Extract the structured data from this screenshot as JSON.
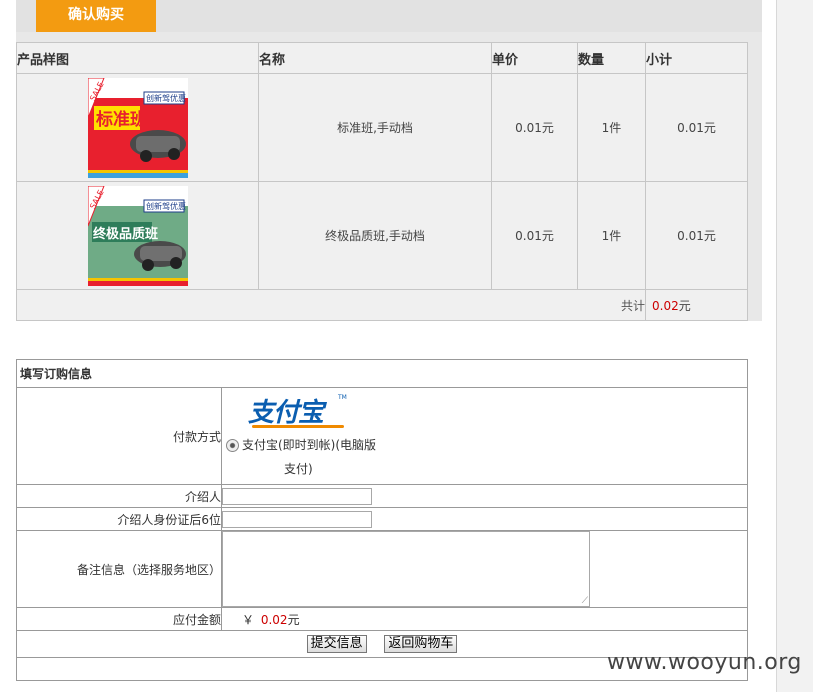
{
  "header": {
    "confirm_tab": "确认购买"
  },
  "cart": {
    "headers": [
      "产品样图",
      "名称",
      "单价",
      "数量",
      "小计"
    ],
    "rows": [
      {
        "name": "标准班,手动档",
        "price": "0.01元",
        "qty": "1件",
        "subtotal": "0.01元",
        "thumb": {
          "ribbon": "SALE",
          "title": "标准班",
          "promo": "创新驾优惠",
          "bg": "#e8202e"
        }
      },
      {
        "name": "终极品质班,手动档",
        "price": "0.01元",
        "qty": "1件",
        "subtotal": "0.01元",
        "thumb": {
          "ribbon": "SALE",
          "title": "终极品质班",
          "promo": "创新驾优惠",
          "bg": "#6fab86"
        }
      }
    ],
    "total_label": "共计",
    "total_value": "0.02",
    "total_unit": "元"
  },
  "order": {
    "title": "填写订购信息",
    "payment_label": "付款方式",
    "alipay_logo": "支付宝",
    "alipay_tm": "TM",
    "payment_option_line1": "支付宝(即时到帐)(电脑版",
    "payment_option_line2": "支付)",
    "referrer_label": "介绍人",
    "referrer_value": "",
    "referrer_id_label": "介绍人身份证后6位",
    "referrer_id_value": "",
    "remark_label": "备注信息（选择服务地区）",
    "amount_label": "应付金额",
    "amount_currency": "￥",
    "amount_value": "0.02",
    "amount_unit": "元",
    "submit_button": "提交信息",
    "back_button": "返回购物车"
  },
  "watermark": "www.wooyun.org",
  "colors": {
    "accent": "#f39b11",
    "price": "#cc0000",
    "alipay_blue": "#0b5eb0",
    "alipay_orange": "#f08a00"
  }
}
